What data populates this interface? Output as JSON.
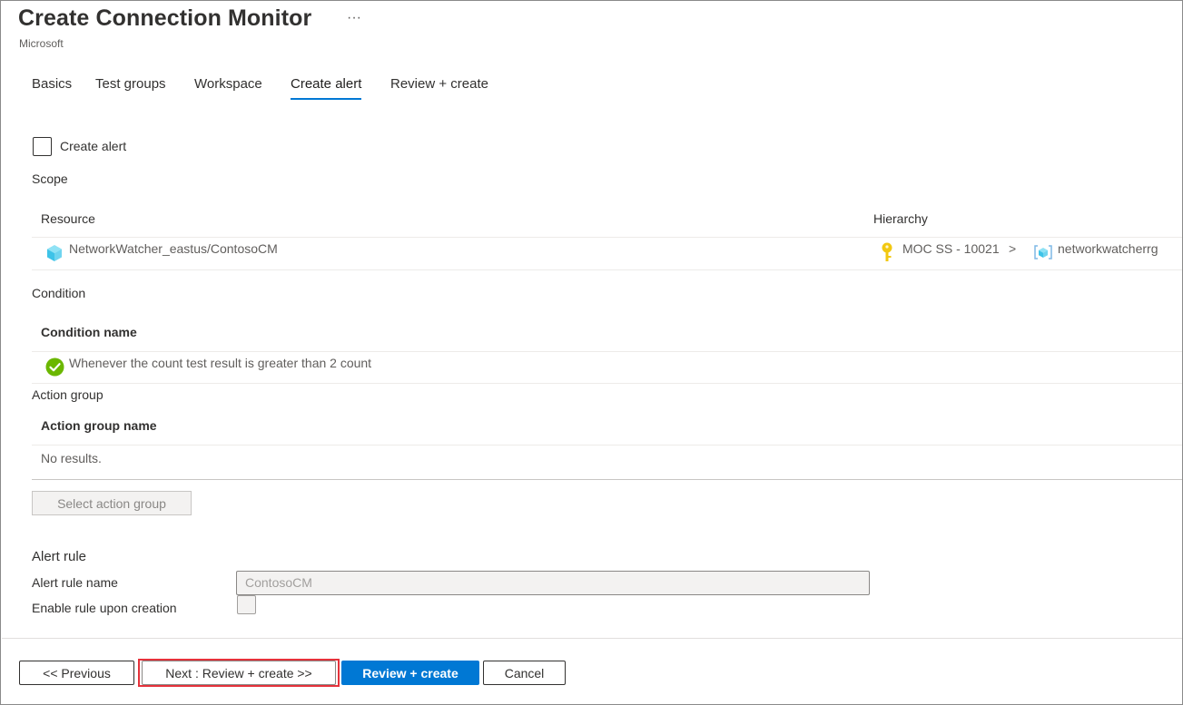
{
  "header": {
    "title": "Create Connection Monitor",
    "more": "···",
    "subtitle": "Microsoft"
  },
  "tabs": [
    {
      "label": "Basics",
      "active": false
    },
    {
      "label": "Test groups",
      "active": false
    },
    {
      "label": "Workspace",
      "active": false
    },
    {
      "label": "Create alert",
      "active": true
    },
    {
      "label": "Review + create",
      "active": false
    }
  ],
  "create_alert": {
    "label": "Create alert",
    "checked": false
  },
  "scope": {
    "label": "Scope",
    "columns": [
      "Resource",
      "Hierarchy"
    ],
    "row": {
      "resource": "NetworkWatcher_eastus/ContosoCM",
      "resource_icon": "resource-cube-icon",
      "subscription": "MOC SS - 10021",
      "subscription_icon": "key-icon",
      "separator": ">",
      "resource_group": "networkwatcherrg",
      "resource_group_icon": "resource-group-icon"
    }
  },
  "condition": {
    "label": "Condition",
    "column": "Condition name",
    "row": "Whenever the count test result is greater than 2 count",
    "row_icon": "check-circle-icon"
  },
  "action_group": {
    "label": "Action group",
    "column": "Action group name",
    "empty": "No results.",
    "button": "Select action group"
  },
  "alert_rule": {
    "label": "Alert rule",
    "name_label": "Alert rule name",
    "name_value": "ContosoCM",
    "enable_label": "Enable rule upon creation",
    "enable_checked": false
  },
  "footer": {
    "previous": "<< Previous",
    "next": "Next : Review + create >>",
    "review_create": "Review + create",
    "cancel": "Cancel"
  },
  "colors": {
    "accent": "#0078d4",
    "highlight": "#e5323b",
    "success": "#6bb700",
    "key": "#f2c811"
  }
}
